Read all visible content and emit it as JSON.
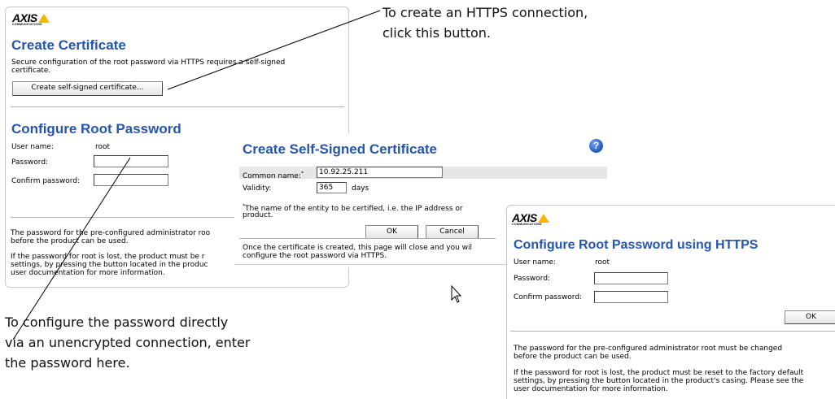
{
  "callouts": {
    "https_line1": "To create an HTTPS connection,",
    "https_line2": "click this button.",
    "password_line1": "To configure the password directly",
    "password_line2": "via an unencrypted connection, enter",
    "password_line3": "the password here."
  },
  "main_window": {
    "logo_text": "AXIS",
    "logo_sub": "COMMUNICATIONS",
    "create_cert_title": "Create Certificate",
    "create_cert_desc_1": "Secure configuration of the root password via HTTPS requires a self-signed",
    "create_cert_desc_2": "certificate.",
    "create_cert_button": "Create self-signed certificate...",
    "root_pw_title": "Configure Root Password",
    "user_name_label": "User name:",
    "user_name_value": "root",
    "password_label": "Password:",
    "confirm_label": "Confirm password:",
    "note1_line1": "The password for the pre-configured administrator roo",
    "note1_line2": "before the product can be used.",
    "note2_line1": "If the password for root is lost, the product must be r",
    "note2_line2": "settings, by pressing the button located in the produc",
    "note2_line3": "user documentation for more information."
  },
  "cert_dialog": {
    "title": "Create Self-Signed Certificate",
    "help_icon_glyph": "?",
    "common_name_label": "Common name:",
    "common_name_marker": "*",
    "common_name_value": "10.92.25.211",
    "validity_label": "Validity:",
    "validity_value": "365",
    "validity_unit": "days",
    "footnote_marker": "*",
    "footnote_line1": "The name of the entity to be certified, i.e. the IP address or",
    "footnote_line2": "product.",
    "ok_button": "OK",
    "cancel_button": "Cancel",
    "info_line1": "Once the certificate is created, this page will close and you wil",
    "info_line2": "configure the root password via HTTPS."
  },
  "https_window": {
    "logo_text": "AXIS",
    "logo_sub": "COMMUNICATIONS",
    "title": "Configure Root Password using HTTPS",
    "user_name_label": "User name:",
    "user_name_value": "root",
    "password_label": "Password:",
    "confirm_label": "Confirm password:",
    "ok_button": "OK",
    "note1_line1": "The password for the pre-configured administrator root must be changed",
    "note1_line2": "before the product can be used.",
    "note2_line1": "If the password for root is lost, the product must be reset to the factory default",
    "note2_line2": "settings, by pressing the button located in the product's casing. Please see the",
    "note2_line3": "user documentation for more information."
  },
  "colors": {
    "title_blue": "#2456b0",
    "logo_yellow": "#f2b800",
    "help_icon_blue": "#2a62c8"
  }
}
